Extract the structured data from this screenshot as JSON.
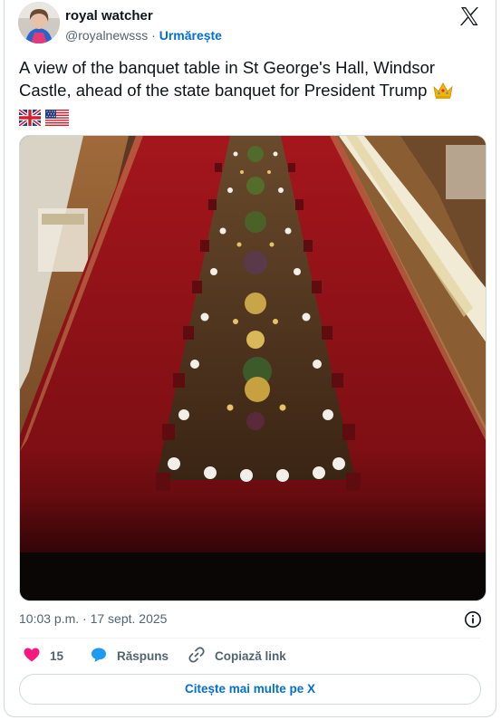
{
  "author": {
    "display_name": "royal watcher",
    "handle": "@royalnewsss",
    "separator": "·",
    "follow_label": "Urmărește"
  },
  "tweet": {
    "text": "A view of the banquet table in St George's Hall, Windsor Castle, ahead of the state banquet for President Trump",
    "emojis": [
      "crown",
      "flag-united-kingdom",
      "flag-united-states"
    ],
    "timestamp": "10:03 p.m. · 17 sept. 2025"
  },
  "actions": {
    "likes_count": "15",
    "reply_label": "Răspuns",
    "copy_link_label": "Copiază link"
  },
  "footer": {
    "read_more_label": "Citește mai multe pe X"
  },
  "colors": {
    "accent": "#006fd6",
    "like": "#f91880",
    "reply": "#1d9bf0",
    "muted": "#536471",
    "carpet": "#8f1418"
  }
}
